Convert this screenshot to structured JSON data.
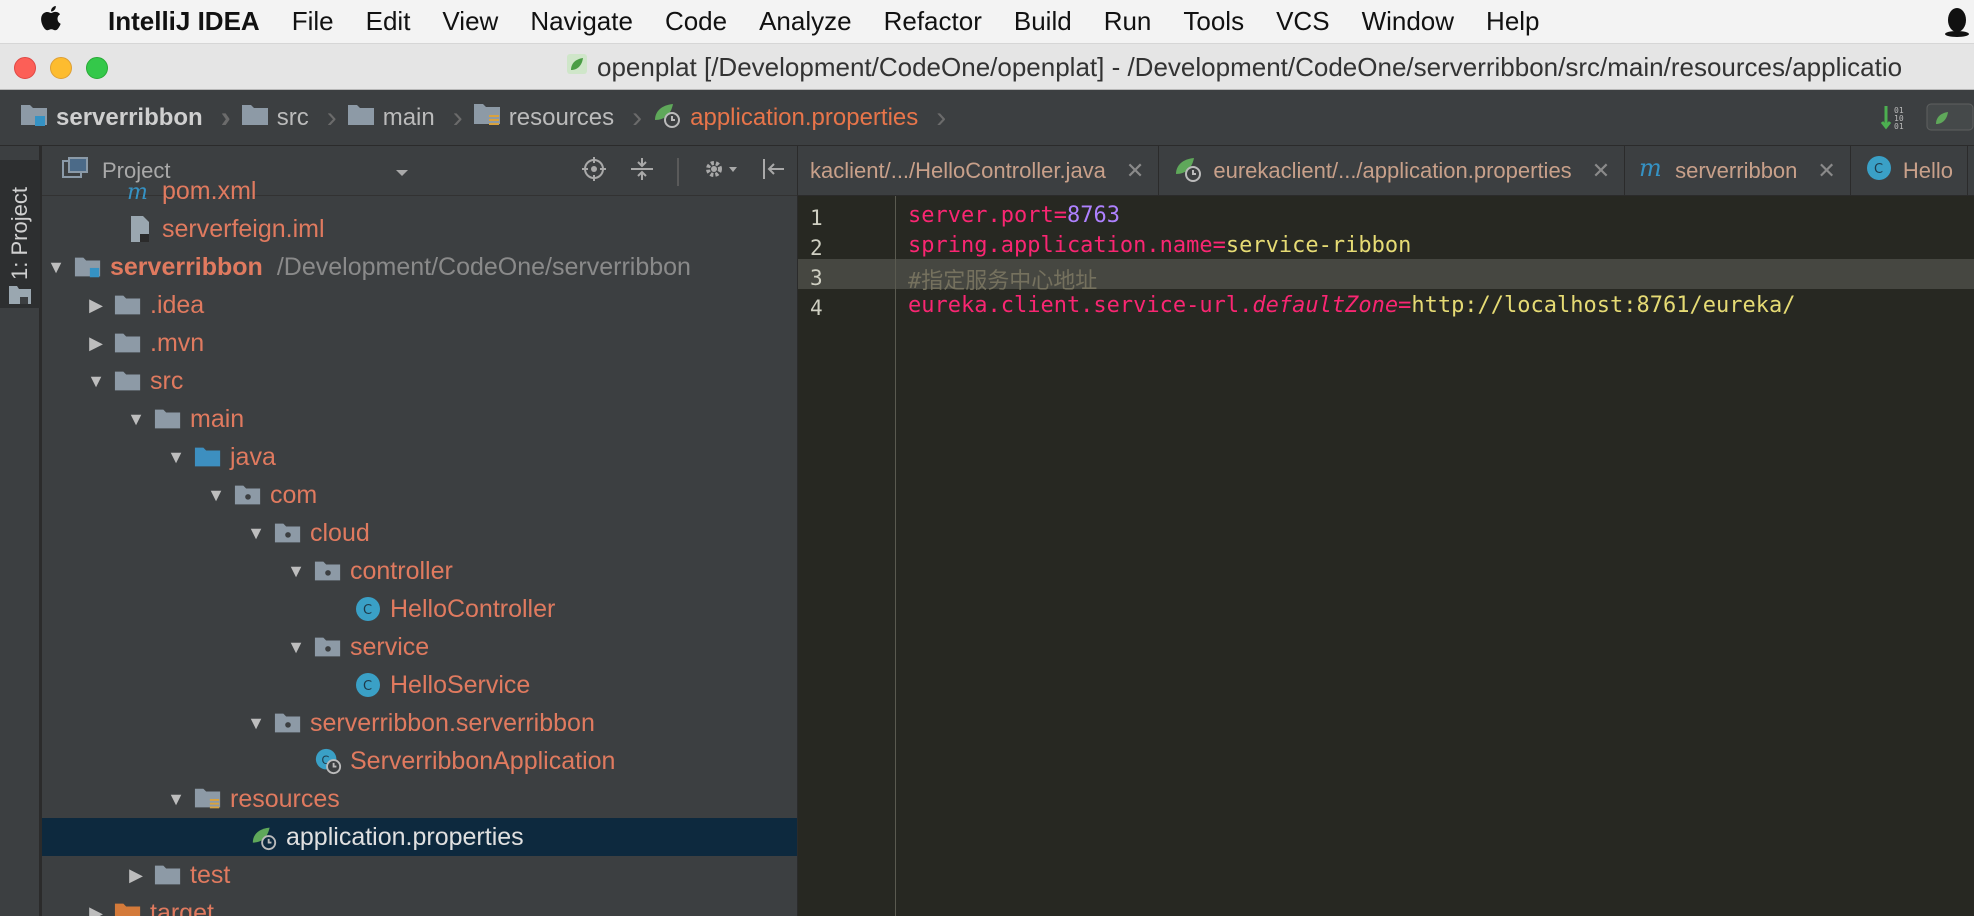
{
  "menubar": {
    "app_name": "IntelliJ IDEA",
    "items": [
      "File",
      "Edit",
      "View",
      "Navigate",
      "Code",
      "Analyze",
      "Refactor",
      "Build",
      "Run",
      "Tools",
      "VCS",
      "Window",
      "Help"
    ]
  },
  "titlebar": {
    "title": "openplat [/Development/CodeOne/openplat] - /Development/CodeOne/serverribbon/src/main/resources/applicatio"
  },
  "breadcrumbs": [
    "serverribbon",
    "src",
    "main",
    "resources",
    "application.properties"
  ],
  "toolstrip": {
    "project_tab": "1: Project"
  },
  "project_panel": {
    "title": "Project",
    "tree": [
      {
        "label": "pom.xml",
        "path": ""
      },
      {
        "label": "serverfeign.iml",
        "path": ""
      },
      {
        "label": "serverribbon",
        "path": "/Development/CodeOne/serverribbon"
      },
      {
        "label": ".idea",
        "path": ""
      },
      {
        "label": ".mvn",
        "path": ""
      },
      {
        "label": "src",
        "path": ""
      },
      {
        "label": "main",
        "path": ""
      },
      {
        "label": "java",
        "path": ""
      },
      {
        "label": "com",
        "path": ""
      },
      {
        "label": "cloud",
        "path": ""
      },
      {
        "label": "controller",
        "path": ""
      },
      {
        "label": "HelloController",
        "path": ""
      },
      {
        "label": "service",
        "path": ""
      },
      {
        "label": "HelloService",
        "path": ""
      },
      {
        "label": "serverribbon.serverribbon",
        "path": ""
      },
      {
        "label": "ServerribbonApplication",
        "path": ""
      },
      {
        "label": "resources",
        "path": ""
      },
      {
        "label": "application.properties",
        "path": ""
      },
      {
        "label": "test",
        "path": ""
      },
      {
        "label": "target",
        "path": ""
      }
    ]
  },
  "editor": {
    "tabs": [
      {
        "label": "kaclient/.../HelloController.java"
      },
      {
        "label": "eurekaclient/.../application.properties"
      },
      {
        "label": "serverribbon"
      },
      {
        "label": "Hello"
      }
    ],
    "line_numbers": [
      "1",
      "2",
      "3",
      "4"
    ],
    "lines": [
      {
        "key": "server.port",
        "eq": "=",
        "value": "8763"
      },
      {
        "key": "spring.application.name",
        "eq": "=",
        "value": "service-ribbon"
      },
      {
        "comment": "#指定服务中心地址"
      },
      {
        "key_prefix": "eureka.client.service-url.",
        "key_italic": "defaultZone",
        "eq": "=",
        "value": "http://localhost:8761/eureka/"
      }
    ]
  }
}
